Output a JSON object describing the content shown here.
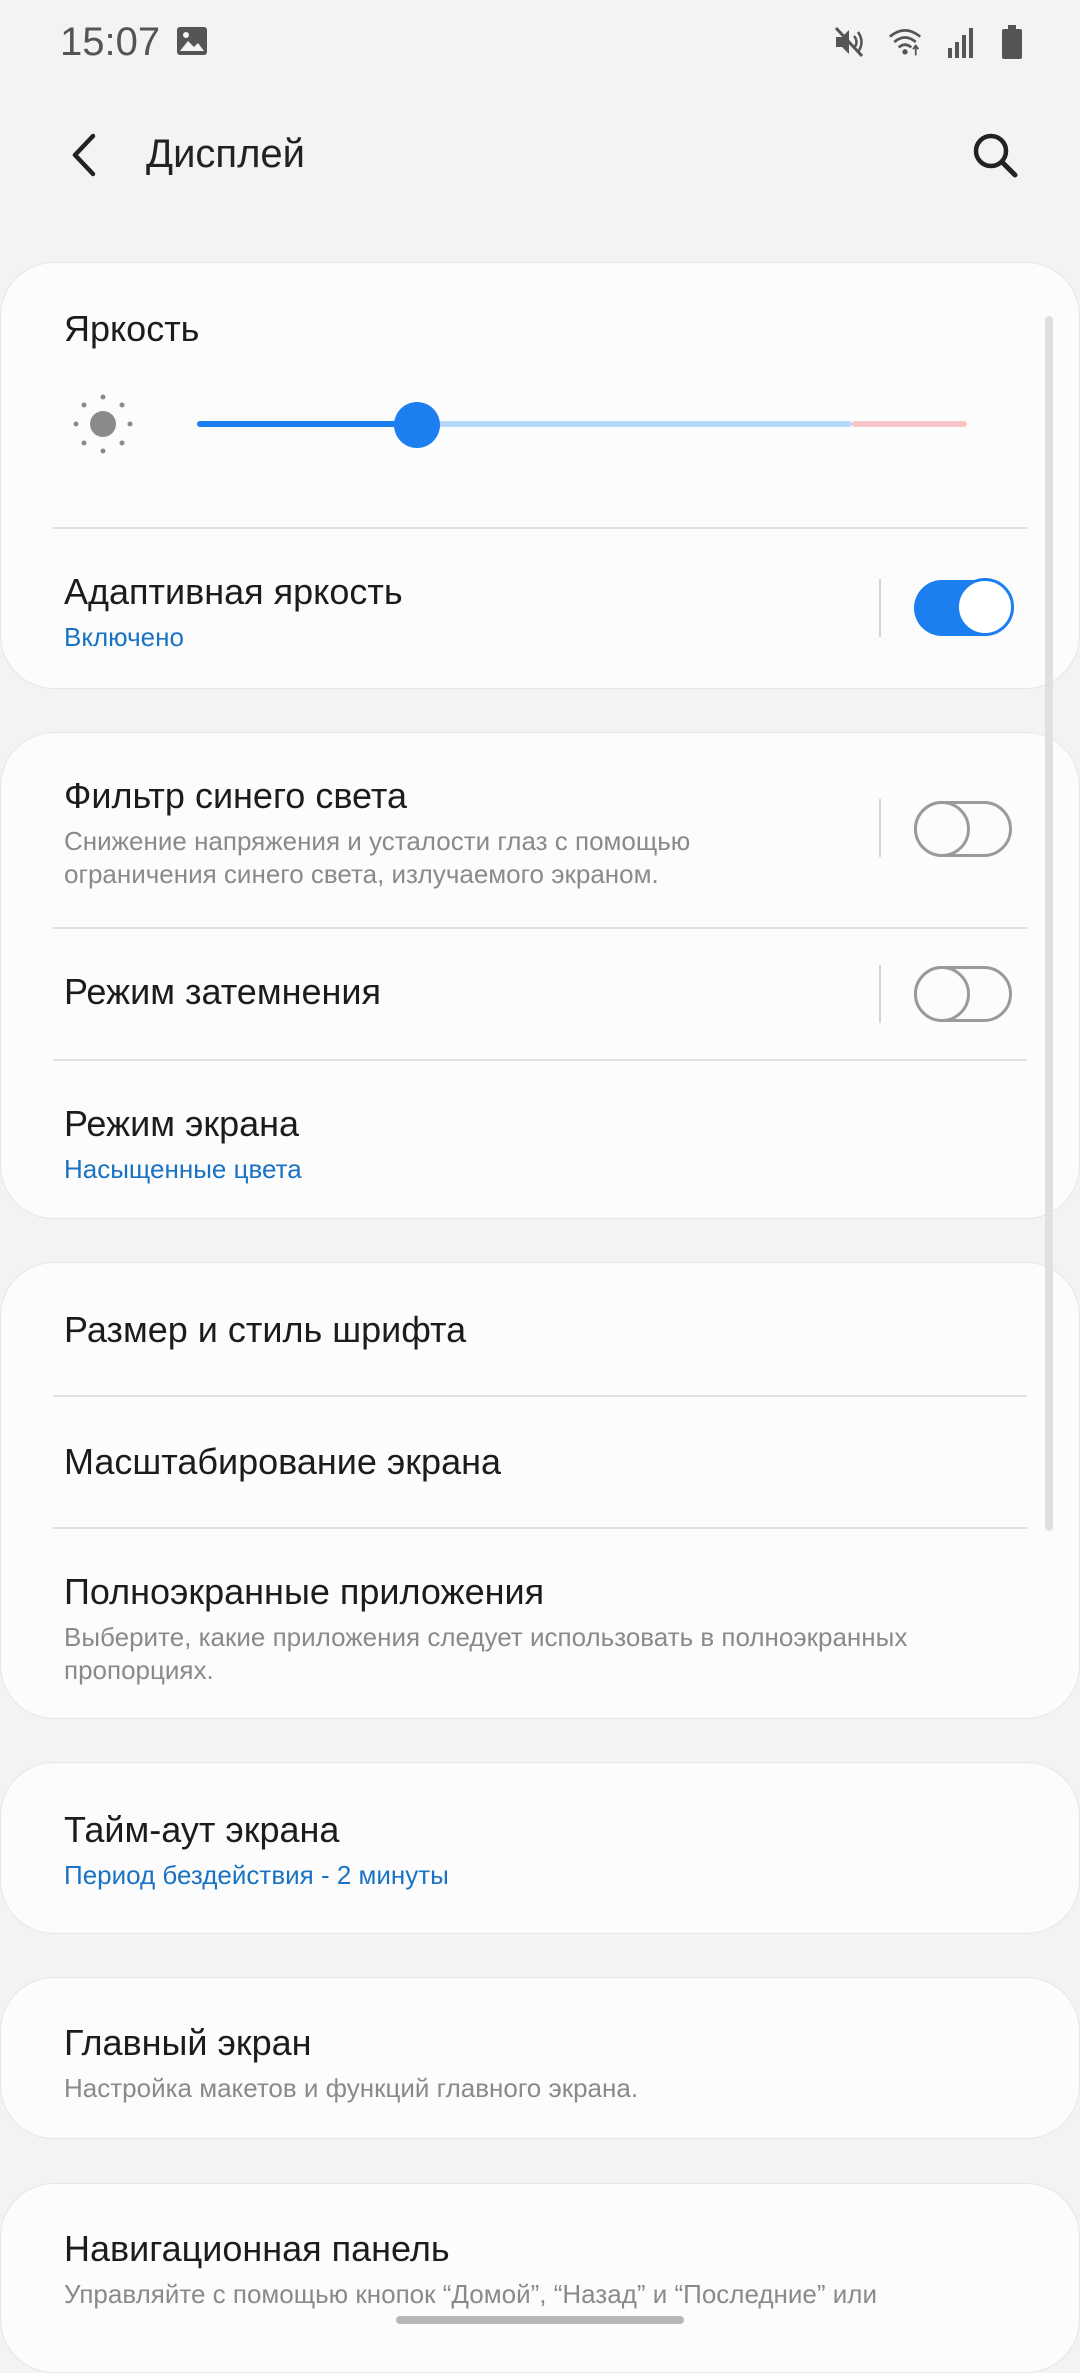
{
  "status_bar": {
    "time": "15:07",
    "icons": [
      "image-icon",
      "mute-icon",
      "wifi-icon",
      "signal-icon",
      "battery-icon"
    ]
  },
  "header": {
    "title": "Дисплей",
    "back_icon": "back-arrow-icon",
    "search_icon": "search-icon"
  },
  "brightness": {
    "title": "Яркость",
    "level": 0.286,
    "adaptive_title": "Адаптивная яркость",
    "adaptive_status": "Включено",
    "adaptive_on": true
  },
  "display_group": {
    "blue_filter_title": "Фильтр синего света",
    "blue_filter_desc_line1": "Снижение напряжения и усталости глаз с помощью",
    "blue_filter_desc_line2": "ограничения синего света, излучаемого экраном.",
    "blue_filter_on": false,
    "dark_mode_title": "Режим затемнения",
    "dark_mode_on": false,
    "screen_mode_title": "Режим экрана",
    "screen_mode_value": "Насыщенные цвета"
  },
  "font_group": {
    "font_title": "Размер и стиль шрифта",
    "zoom_title": "Масштабирование экрана",
    "fullscreen_title": "Полноэкранные приложения",
    "fullscreen_desc_line1": "Выберите, какие приложения следует использовать в полноэкранных",
    "fullscreen_desc_line2": "пропорциях."
  },
  "timeout": {
    "title": "Тайм-аут экрана",
    "value": "Период бездействия - 2 минуты"
  },
  "home_screen": {
    "title": "Главный экран",
    "desc": "Настройка макетов и функций главного экрана."
  },
  "nav_bar": {
    "title": "Навигационная панель",
    "desc": "Управляйте с помощью кнопок “Домой”, “Назад” и “Последние” или"
  },
  "colors": {
    "accent": "#1c7ff0",
    "link_blue": "#1a73c2",
    "background": "#f3f3f3",
    "card": "#fcfcfc"
  }
}
